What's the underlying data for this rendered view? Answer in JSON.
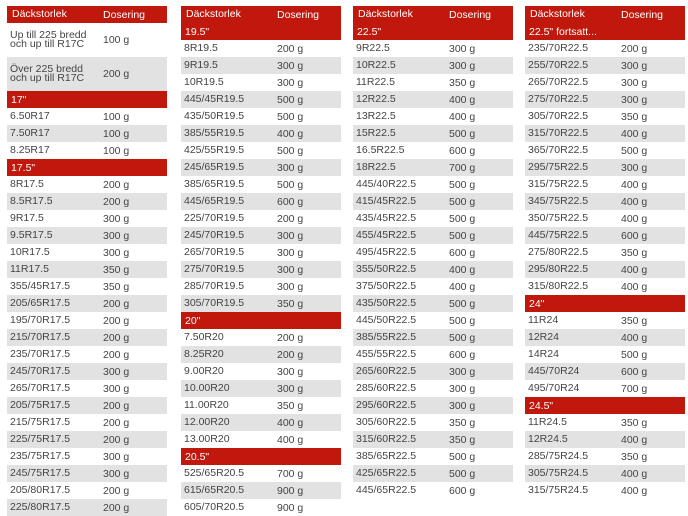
{
  "header": {
    "size": "Däckstorlek",
    "dose": "Dosering"
  },
  "columns": [
    [
      {
        "kind": "row",
        "size": "Up till 225 bredd och up till R17C",
        "dose": "100 g",
        "tall": true
      },
      {
        "kind": "row",
        "size": "Över 225 bredd och up till R17C",
        "dose": "200 g",
        "tall": true
      },
      {
        "kind": "section",
        "label": "17\""
      },
      {
        "kind": "row",
        "size": "6.50R17",
        "dose": "100 g"
      },
      {
        "kind": "row",
        "size": "7.50R17",
        "dose": "100 g"
      },
      {
        "kind": "row",
        "size": "8.25R17",
        "dose": "100 g"
      },
      {
        "kind": "section",
        "label": "17.5\""
      },
      {
        "kind": "row",
        "size": "8R17.5",
        "dose": "200 g"
      },
      {
        "kind": "row",
        "size": "8.5R17.5",
        "dose": "200 g"
      },
      {
        "kind": "row",
        "size": "9R17.5",
        "dose": "300 g"
      },
      {
        "kind": "row",
        "size": "9.5R17.5",
        "dose": "300 g"
      },
      {
        "kind": "row",
        "size": "10R17.5",
        "dose": "300 g"
      },
      {
        "kind": "row",
        "size": "11R17.5",
        "dose": "350 g"
      },
      {
        "kind": "row",
        "size": "355/45R17.5",
        "dose": "350 g"
      },
      {
        "kind": "row",
        "size": "205/65R17.5",
        "dose": "200 g"
      },
      {
        "kind": "row",
        "size": "195/70R17.5",
        "dose": "200 g"
      },
      {
        "kind": "row",
        "size": "215/70R17.5",
        "dose": "200 g"
      },
      {
        "kind": "row",
        "size": "235/70R17.5",
        "dose": "200 g"
      },
      {
        "kind": "row",
        "size": "245/70R17.5",
        "dose": "300 g"
      },
      {
        "kind": "row",
        "size": "265/70R17.5",
        "dose": "300 g"
      },
      {
        "kind": "row",
        "size": "205/75R17.5",
        "dose": "200 g"
      },
      {
        "kind": "row",
        "size": "215/75R17.5",
        "dose": "200 g"
      },
      {
        "kind": "row",
        "size": "225/75R17.5",
        "dose": "200 g"
      },
      {
        "kind": "row",
        "size": "235/75R17.5",
        "dose": "300 g"
      },
      {
        "kind": "row",
        "size": "245/75R17.5",
        "dose": "300 g"
      },
      {
        "kind": "row",
        "size": "205/80R17.5",
        "dose": "200 g"
      },
      {
        "kind": "row",
        "size": "225/80R17.5",
        "dose": "200 g"
      }
    ],
    [
      {
        "kind": "section",
        "label": "19.5\""
      },
      {
        "kind": "row",
        "size": "8R19.5",
        "dose": "200 g"
      },
      {
        "kind": "row",
        "size": "9R19.5",
        "dose": "300 g"
      },
      {
        "kind": "row",
        "size": "10R19.5",
        "dose": "300 g"
      },
      {
        "kind": "row",
        "size": "445/45R19.5",
        "dose": "500 g"
      },
      {
        "kind": "row",
        "size": "435/50R19.5",
        "dose": "500 g"
      },
      {
        "kind": "row",
        "size": "385/55R19.5",
        "dose": "400 g"
      },
      {
        "kind": "row",
        "size": "425/55R19.5",
        "dose": "500 g"
      },
      {
        "kind": "row",
        "size": "245/65R19.5",
        "dose": "300 g"
      },
      {
        "kind": "row",
        "size": "385/65R19.5",
        "dose": "500 g"
      },
      {
        "kind": "row",
        "size": "445/65R19.5",
        "dose": "600 g"
      },
      {
        "kind": "row",
        "size": "225/70R19.5",
        "dose": "200 g"
      },
      {
        "kind": "row",
        "size": "245/70R19.5",
        "dose": "300 g"
      },
      {
        "kind": "row",
        "size": "265/70R19.5",
        "dose": "300 g"
      },
      {
        "kind": "row",
        "size": "275/70R19.5",
        "dose": "300 g"
      },
      {
        "kind": "row",
        "size": "285/70R19.5",
        "dose": "300 g"
      },
      {
        "kind": "row",
        "size": "305/70R19.5",
        "dose": "350 g"
      },
      {
        "kind": "section",
        "label": "20\""
      },
      {
        "kind": "row",
        "size": "7.50R20",
        "dose": "200 g"
      },
      {
        "kind": "row",
        "size": "8.25R20",
        "dose": "200 g"
      },
      {
        "kind": "row",
        "size": "9.00R20",
        "dose": "300 g"
      },
      {
        "kind": "row",
        "size": "10.00R20",
        "dose": "300 g"
      },
      {
        "kind": "row",
        "size": "11.00R20",
        "dose": "350 g"
      },
      {
        "kind": "row",
        "size": "12.00R20",
        "dose": "400 g"
      },
      {
        "kind": "row",
        "size": "13.00R20",
        "dose": "400 g"
      },
      {
        "kind": "section",
        "label": "20.5\""
      },
      {
        "kind": "row",
        "size": "525/65R20.5",
        "dose": "700 g"
      },
      {
        "kind": "row",
        "size": "615/65R20.5",
        "dose": "900 g"
      },
      {
        "kind": "row",
        "size": "605/70R20.5",
        "dose": "900 g"
      }
    ],
    [
      {
        "kind": "section",
        "label": "22.5\""
      },
      {
        "kind": "row",
        "size": "9R22.5",
        "dose": "300 g"
      },
      {
        "kind": "row",
        "size": "10R22.5",
        "dose": "300 g"
      },
      {
        "kind": "row",
        "size": "11R22.5",
        "dose": "350 g"
      },
      {
        "kind": "row",
        "size": "12R22.5",
        "dose": "400 g"
      },
      {
        "kind": "row",
        "size": "13R22.5",
        "dose": "400 g"
      },
      {
        "kind": "row",
        "size": "15R22.5",
        "dose": "500 g"
      },
      {
        "kind": "row",
        "size": "16.5R22.5",
        "dose": "600 g"
      },
      {
        "kind": "row",
        "size": "18R22.5",
        "dose": "700 g"
      },
      {
        "kind": "row",
        "size": "445/40R22.5",
        "dose": "500 g"
      },
      {
        "kind": "row",
        "size": "415/45R22.5",
        "dose": "500 g"
      },
      {
        "kind": "row",
        "size": "435/45R22.5",
        "dose": "500 g"
      },
      {
        "kind": "row",
        "size": "455/45R22.5",
        "dose": "500 g"
      },
      {
        "kind": "row",
        "size": "495/45R22.5",
        "dose": "600 g"
      },
      {
        "kind": "row",
        "size": "355/50R22.5",
        "dose": "400 g"
      },
      {
        "kind": "row",
        "size": "375/50R22.5",
        "dose": "400 g"
      },
      {
        "kind": "row",
        "size": "435/50R22.5",
        "dose": "500 g"
      },
      {
        "kind": "row",
        "size": "445/50R22.5",
        "dose": "500 g"
      },
      {
        "kind": "row",
        "size": "385/55R22.5",
        "dose": "500 g"
      },
      {
        "kind": "row",
        "size": "455/55R22.5",
        "dose": "600 g"
      },
      {
        "kind": "row",
        "size": "265/60R22.5",
        "dose": "300 g"
      },
      {
        "kind": "row",
        "size": "285/60R22.5",
        "dose": "300 g"
      },
      {
        "kind": "row",
        "size": "295/60R22.5",
        "dose": "300 g"
      },
      {
        "kind": "row",
        "size": "305/60R22.5",
        "dose": "350 g"
      },
      {
        "kind": "row",
        "size": "315/60R22.5",
        "dose": "350 g"
      },
      {
        "kind": "row",
        "size": "385/65R22.5",
        "dose": "500 g"
      },
      {
        "kind": "row",
        "size": "425/65R22.5",
        "dose": "500 g"
      },
      {
        "kind": "row",
        "size": "445/65R22.5",
        "dose": "600 g"
      }
    ],
    [
      {
        "kind": "section",
        "label": "22.5\" fortsatt..."
      },
      {
        "kind": "row",
        "size": "235/70R22.5",
        "dose": "200 g"
      },
      {
        "kind": "row",
        "size": "255/70R22.5",
        "dose": "300 g"
      },
      {
        "kind": "row",
        "size": "265/70R22.5",
        "dose": "300 g"
      },
      {
        "kind": "row",
        "size": "275/70R22.5",
        "dose": "300 g"
      },
      {
        "kind": "row",
        "size": "305/70R22.5",
        "dose": "350 g"
      },
      {
        "kind": "row",
        "size": "315/70R22.5",
        "dose": "400 g"
      },
      {
        "kind": "row",
        "size": "365/70R22.5",
        "dose": "500 g"
      },
      {
        "kind": "row",
        "size": "295/75R22.5",
        "dose": "300 g"
      },
      {
        "kind": "row",
        "size": "315/75R22.5",
        "dose": "400 g"
      },
      {
        "kind": "row",
        "size": "345/75R22.5",
        "dose": "400 g"
      },
      {
        "kind": "row",
        "size": "350/75R22.5",
        "dose": "400 g"
      },
      {
        "kind": "row",
        "size": "445/75R22.5",
        "dose": "600 g"
      },
      {
        "kind": "row",
        "size": "275/80R22.5",
        "dose": "350 g"
      },
      {
        "kind": "row",
        "size": "295/80R22.5",
        "dose": "400 g"
      },
      {
        "kind": "row",
        "size": "315/80R22.5",
        "dose": "400 g"
      },
      {
        "kind": "section",
        "label": "24\""
      },
      {
        "kind": "row",
        "size": "11R24",
        "dose": "350 g"
      },
      {
        "kind": "row",
        "size": "12R24",
        "dose": "400 g"
      },
      {
        "kind": "row",
        "size": "14R24",
        "dose": "500 g"
      },
      {
        "kind": "row",
        "size": "445/70R24",
        "dose": "600 g"
      },
      {
        "kind": "row",
        "size": "495/70R24",
        "dose": "700 g"
      },
      {
        "kind": "section",
        "label": "24.5\""
      },
      {
        "kind": "row",
        "size": "11R24.5",
        "dose": "350 g"
      },
      {
        "kind": "row",
        "size": "12R24.5",
        "dose": "400 g"
      },
      {
        "kind": "row",
        "size": "285/75R24.5",
        "dose": "350 g"
      },
      {
        "kind": "row",
        "size": "305/75R24.5",
        "dose": "400 g"
      },
      {
        "kind": "row",
        "size": "315/75R24.5",
        "dose": "400 g"
      }
    ]
  ]
}
